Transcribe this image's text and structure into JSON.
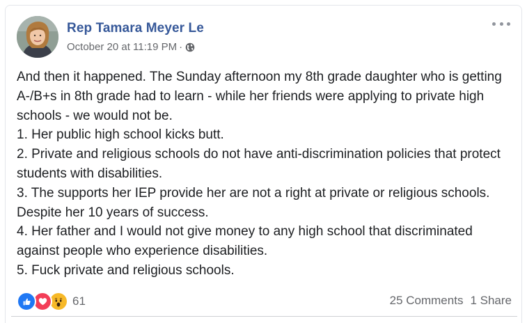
{
  "post": {
    "author": "Rep Tamara Meyer Le",
    "timestamp": "October 20 at 11:19 PM",
    "separator": "·",
    "privacy_icon": "globe-icon",
    "more_icon": "ellipsis-icon",
    "lines": [
      "And then it happened. The Sunday afternoon my 8th grade daughter who is getting A-/B+s in 8th grade had to learn - while her friends were applying to private high schools - we would not be.",
      "1. Her public high school kicks butt.",
      "2. Private and religious schools do not have anti-discrimination policies that protect students with disabilities.",
      "3. The supports her IEP provide her are not a right at private or religious schools. Despite her 10 years of success.",
      "4. Her father and I would not give money to any high school that discriminated against people who experience disabilities.",
      "5. Fuck private and religious schools."
    ]
  },
  "footer": {
    "reaction_icons": [
      "like-icon",
      "love-icon",
      "wow-icon"
    ],
    "reaction_count": "61",
    "comments": "25 Comments",
    "shares": "1 Share"
  },
  "colors": {
    "author": "#365899",
    "meta": "#65676b",
    "like": "#2078f4",
    "love": "#f33e58",
    "wow": "#f7b928"
  }
}
